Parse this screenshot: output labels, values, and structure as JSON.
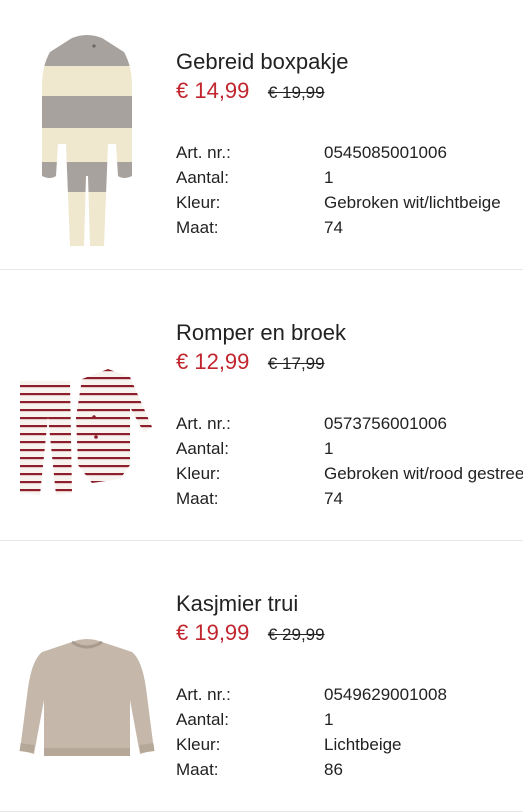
{
  "products": [
    {
      "name": "Gebreid boxpakje",
      "price": "€ 14,99",
      "old_price": "€ 19,99",
      "image_icon": "knitted-romper-image",
      "details": [
        {
          "label": "Art. nr.:",
          "value": "0545085001006"
        },
        {
          "label": "Aantal:",
          "value": "1"
        },
        {
          "label": "Kleur:",
          "value": "Gebroken wit/lichtbeige"
        },
        {
          "label": "Maat:",
          "value": "74"
        }
      ]
    },
    {
      "name": "Romper en broek",
      "price": "€ 12,99",
      "old_price": "€ 17,99",
      "image_icon": "striped-romper-set-image",
      "details": [
        {
          "label": "Art. nr.:",
          "value": "0573756001006"
        },
        {
          "label": "Aantal:",
          "value": "1"
        },
        {
          "label": "Kleur:",
          "value": "Gebroken wit/rood gestreept"
        },
        {
          "label": "Maat:",
          "value": "74"
        }
      ]
    },
    {
      "name": "Kasjmier trui",
      "price": "€ 19,99",
      "old_price": "€ 29,99",
      "image_icon": "cashmere-sweater-image",
      "details": [
        {
          "label": "Art. nr.:",
          "value": "0549629001008"
        },
        {
          "label": "Aantal:",
          "value": "1"
        },
        {
          "label": "Kleur:",
          "value": "Lichtbeige"
        },
        {
          "label": "Maat:",
          "value": "86"
        }
      ]
    }
  ],
  "colors": {
    "sale_price": "#c1262e",
    "text": "#222222",
    "divider": "#e8e8e8"
  }
}
